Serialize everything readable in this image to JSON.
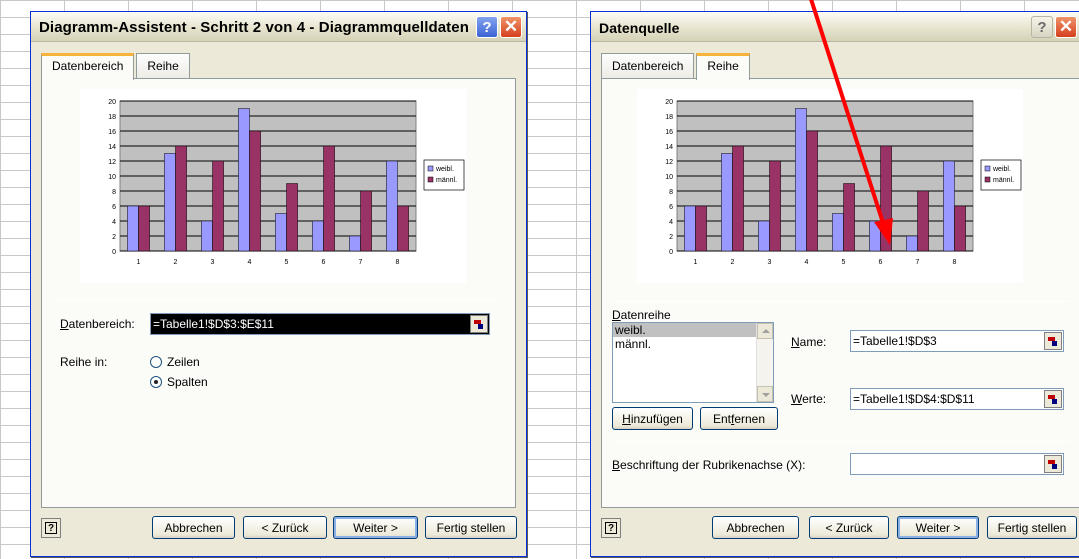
{
  "dialog1": {
    "title": "Diagramm-Assistent - Schritt 2 von 4 - Diagrammquelldaten",
    "help_glyph": "?",
    "close_glyph": "✕",
    "tabs": [
      {
        "label": "Datenbereich"
      },
      {
        "label": "Reihe"
      }
    ],
    "range_label": "Datenbereich:",
    "range_value": "=Tabelle1!$D$3:$E$11",
    "series_in_label": "Reihe in:",
    "radio_rows": "Zeilen",
    "radio_columns": "Spalten",
    "selected_radio": "Spalten",
    "buttons": {
      "cancel": "Abbrechen",
      "back": "< Zurück",
      "next": "Weiter >",
      "finish": "Fertig stellen"
    }
  },
  "dialog2": {
    "title": "Datenquelle",
    "help_glyph": "?",
    "close_glyph": "✕",
    "tabs": [
      {
        "label": "Datenbereich"
      },
      {
        "label": "Reihe"
      }
    ],
    "series_label": "Datenreihe",
    "series_items": [
      "weibl.",
      "männl."
    ],
    "selected_series": "weibl.",
    "name_label": "Name:",
    "name_value": "=Tabelle1!$D$3",
    "values_label": "Werte:",
    "values_value": "=Tabelle1!$D$4:$D$11",
    "add_button": "Hinzufügen",
    "remove_button": "Entfernen",
    "category_label": "Beschriftung der Rubrikenachse (X):",
    "category_value": "",
    "buttons": {
      "cancel": "Abbrechen",
      "back": "< Zurück",
      "next": "Weiter >",
      "finish": "Fertig stellen"
    }
  },
  "colors": {
    "series_female": "#9999ff",
    "series_male": "#993366",
    "plot_bg": "#c0c0c0",
    "annotation_arrow": "#ff0000"
  },
  "chart_data": [
    {
      "type": "bar",
      "categories": [
        "1",
        "2",
        "3",
        "4",
        "5",
        "6",
        "7",
        "8"
      ],
      "series": [
        {
          "name": "weibl.",
          "values": [
            6,
            13,
            4,
            19,
            5,
            4,
            2,
            12
          ]
        },
        {
          "name": "männl.",
          "values": [
            6,
            14,
            12,
            16,
            9,
            14,
            8,
            6
          ]
        }
      ],
      "y_ticks": [
        "0",
        "2",
        "4",
        "6",
        "8",
        "10",
        "12",
        "14",
        "16",
        "18",
        "20"
      ],
      "ylim": [
        0,
        20
      ],
      "grid": true,
      "legend": "right"
    },
    {
      "type": "bar",
      "categories": [
        "1",
        "2",
        "3",
        "4",
        "5",
        "6",
        "7",
        "8"
      ],
      "series": [
        {
          "name": "weibl.",
          "values": [
            6,
            13,
            4,
            19,
            5,
            4,
            2,
            12
          ]
        },
        {
          "name": "männl.",
          "values": [
            6,
            14,
            12,
            16,
            9,
            14,
            8,
            6
          ]
        }
      ],
      "y_ticks": [
        "0",
        "2",
        "4",
        "6",
        "8",
        "10",
        "12",
        "14",
        "16",
        "18",
        "20"
      ],
      "ylim": [
        0,
        20
      ],
      "grid": true,
      "legend": "right"
    }
  ]
}
